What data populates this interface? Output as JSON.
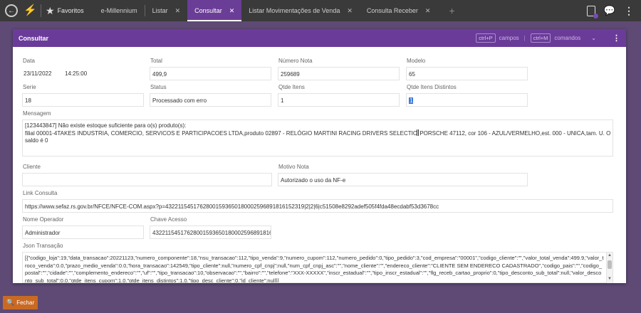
{
  "topbar": {
    "favorites_label": "Favoritos",
    "tabs": [
      {
        "label": "e-Millennium",
        "closable": false
      },
      {
        "label": "Listar",
        "closable": true
      },
      {
        "label": "Consultar",
        "closable": true,
        "active": true
      },
      {
        "label": "Listar Movimentações de Venda",
        "closable": true
      },
      {
        "label": "Consulta Receber",
        "closable": true
      }
    ],
    "plus": "+",
    "close_glyph": "✕"
  },
  "modal": {
    "title": "Consultar",
    "hint_fields_key": "ctrl+P",
    "hint_fields_label": "campos",
    "hint_sep": "|",
    "hint_commands_key": "ctrl+M",
    "hint_commands_label": "comandos"
  },
  "fields": {
    "data": {
      "label": "Data",
      "date": "23/11/2022",
      "time": "14:25:00"
    },
    "total": {
      "label": "Total",
      "value": "499,9"
    },
    "numero_nota": {
      "label": "Número Nota",
      "value": "259689"
    },
    "modelo": {
      "label": "Modelo",
      "value": "65"
    },
    "serie": {
      "label": "Serie",
      "value": "18"
    },
    "status": {
      "label": "Status",
      "value": "Processado com erro"
    },
    "qtde_itens": {
      "label": "Qtde Itens",
      "value": "1"
    },
    "qtde_itens_distintos": {
      "label": "Qtde Itens Distintos",
      "value": "1"
    },
    "mensagem": {
      "label": "Mensagem",
      "line1": "[123443847] Não existe estoque suficiente para o(s) produto(s):",
      "line2a": "filial 00001-4TAKES INDUSTRIA, COMERCIO, SERVICOS E PARTICIPACOES LTDA,produto 02897 - RELÓGIO MARTINI RACING DRIVERS SELECTIO",
      "line2b": " PORSCHE 47112, cor 106 - AZUL/VERMELHO,est. 000 - UNICA,tam. U. O",
      "line3": "saldo é 0"
    },
    "cliente": {
      "label": "Cliente",
      "value": ""
    },
    "motivo_nota": {
      "label": "Motivo Nota",
      "value": "Autorizado o uso da NF-e"
    },
    "link_consulta": {
      "label": "Link Consulta",
      "value": "https://www.sefaz.rs.gov.br/NFCE/NFCE-COM.aspx?p=43221154517628001593650180002596891816152319|2|2|6|c51508e8292adef505f4fda48ecdabf53d3678cc"
    },
    "nome_operador": {
      "label": "Nome Operador",
      "value": "Administrador"
    },
    "chave_acesso": {
      "label": "Chave Acesso",
      "value": "43221154517628001593650180002596891816152319"
    },
    "json_transacao": {
      "label": "Json Transação",
      "value": "[{\"codigo_loja\":19,\"data_transacao\":20221123,\"numero_componente\":18,\"nsu_transacao\":112,\"tipo_venda\":9,\"numero_cupom\":112,\"numero_pedido\":0,\"tipo_pedido\":3,\"cod_empresa\":\"00001\",\"codigo_cliente\":\"\",\"valor_total_venda\":499.9,\"valor_troco_venda\":0.0,\"prazo_medio_venda\":0.0,\"hora_transacao\":142549,\"tipo_cliente\":null,\"numero_cpf_cnpj\":null,\"num_cpf_cnpj_asc\":\"\",\"nome_cliente\":\"\",\"endereco_cliente\":\"CLIENTE  SEM ENDERECO CADASTRADO\",\"codigo_pais\":\"\",\"codigo_postal\":\"\",\"cidade\":\"\",\"complemento_endereco\":\"\",\"uf\":\"\",\"tipo_transacao\":10,\"observacao\":\"\",\"bairro\":\"\",\"telefone\":\"XXX-XXXXX\",\"inscr_estadual\":\"\",\"tipo_inscr_estadual\":\"\",\"flg_receb_cartao_proprio\":0,\"tipo_desconto_sub_total\":null,\"valor_desconto_sub_total\":0.0,\"qtde_itens_cupom\":1.0,\"qtde_itens_distintos\":1.0,\"tipo_desc_cliente\":0,\"id_cliente\":null}]"
    }
  },
  "footer": {
    "close_label": "Fechar"
  }
}
